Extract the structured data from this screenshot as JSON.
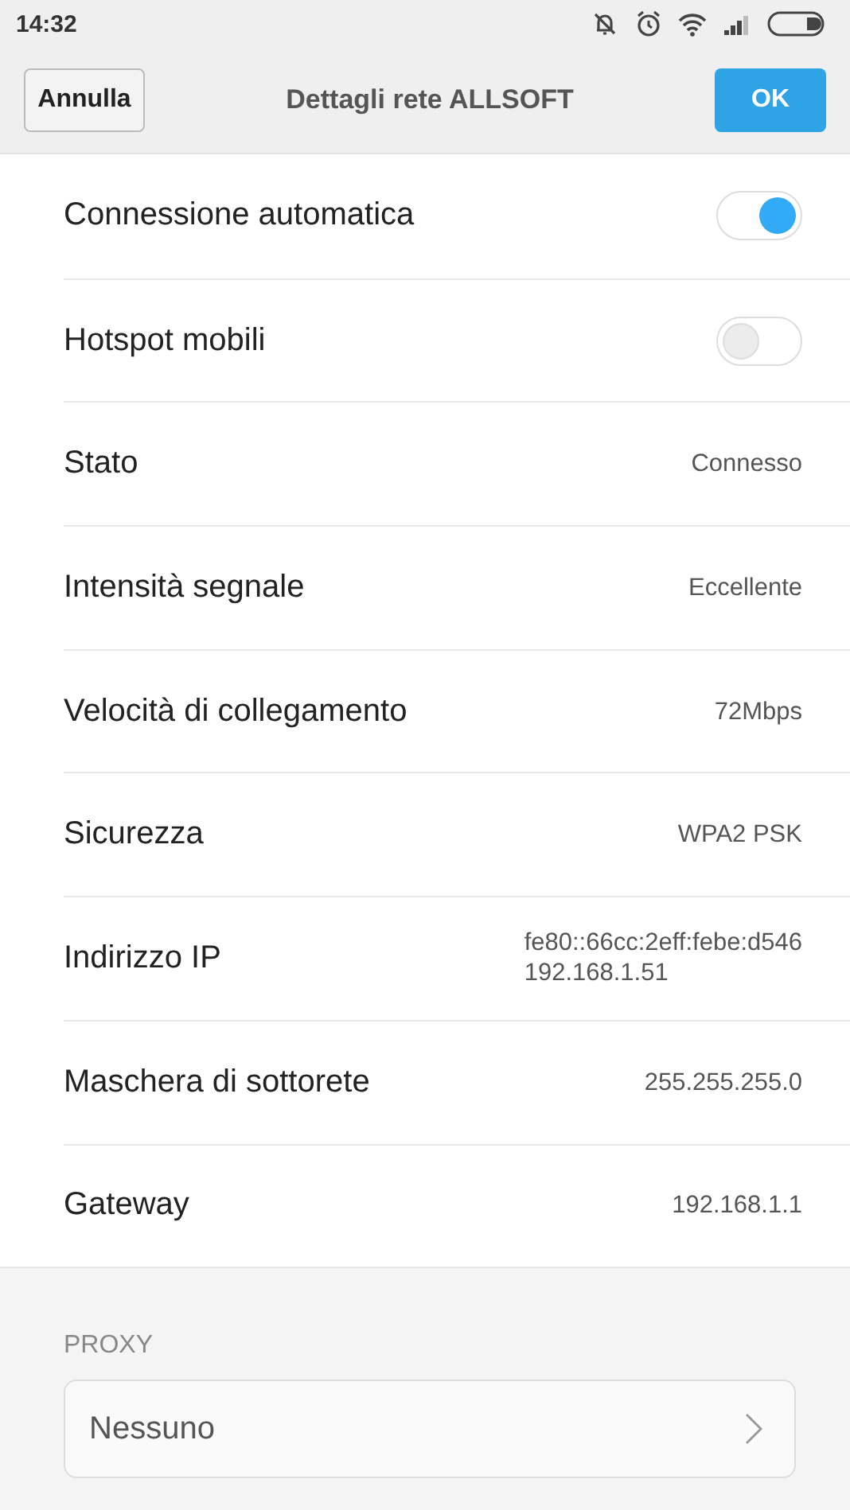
{
  "status_bar": {
    "time": "14:32"
  },
  "header": {
    "cancel": "Annulla",
    "title": "Dettagli rete ALLSOFT",
    "ok": "OK"
  },
  "rows": [
    {
      "kind": "toggle",
      "label": "Connessione automatica",
      "on": true
    },
    {
      "kind": "toggle",
      "label": "Hotspot mobili",
      "on": false
    },
    {
      "kind": "value",
      "label": "Stato",
      "values": [
        "Connesso"
      ]
    },
    {
      "kind": "value",
      "label": "Intensità segnale",
      "values": [
        "Eccellente"
      ]
    },
    {
      "kind": "value",
      "label": "Velocità di collegamento",
      "values": [
        "72Mbps"
      ]
    },
    {
      "kind": "value",
      "label": "Sicurezza",
      "values": [
        "WPA2 PSK"
      ]
    },
    {
      "kind": "value",
      "label": "Indirizzo IP",
      "values": [
        "fe80::66cc:2eff:febe:d546",
        "192.168.1.51"
      ]
    },
    {
      "kind": "value",
      "label": "Maschera di sottorete",
      "values": [
        "255.255.255.0"
      ]
    },
    {
      "kind": "value",
      "label": "Gateway",
      "values": [
        "192.168.1.1"
      ]
    }
  ],
  "proxy": {
    "heading": "PROXY",
    "value": "Nessuno"
  }
}
